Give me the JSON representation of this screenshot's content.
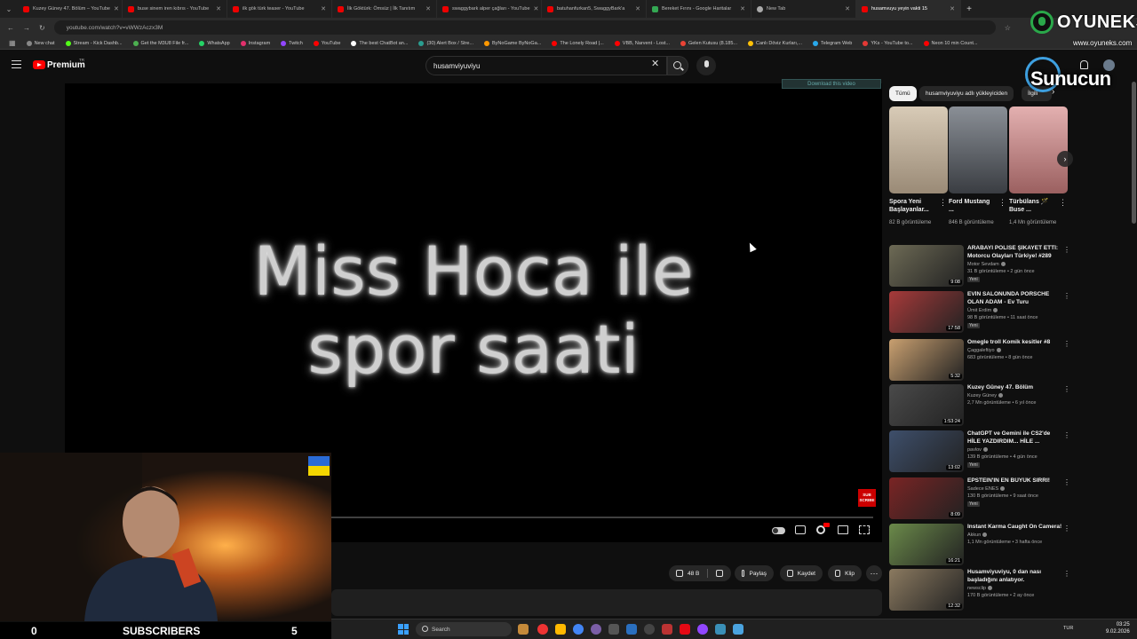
{
  "browser": {
    "tabs": [
      {
        "label": "Kuzey Güney 47. Bölüm – YouTube",
        "icon": "youtube-icon"
      },
      {
        "label": "buse sinem iren kıbrıs - YouTube",
        "icon": "youtube-icon"
      },
      {
        "label": "ilk gök türk teaser - YouTube",
        "icon": "youtube-icon"
      },
      {
        "label": "İlk Göktürk: Ömsüz | İlk Tanıtım",
        "icon": "youtube-icon"
      },
      {
        "label": "swaggybark alper çağları - YouTube",
        "icon": "youtube-icon"
      },
      {
        "label": "batuhanfurkan5, SwaggyBark'a",
        "icon": "youtube-icon"
      },
      {
        "label": "Bereket Fırını - Google Haritalar",
        "icon": "maps-icon"
      },
      {
        "label": "New Tab",
        "icon": "globe-icon"
      },
      {
        "label": "husamvuyu yeyin vakti 15",
        "icon": "youtube-icon"
      }
    ],
    "new_tab": "+",
    "url": "youtube.com/watch?v=vWWzAczx3M",
    "bookmarks": [
      "New chat",
      "Stream - Kick Dashb...",
      "Get the M3U8 File fr...",
      "WhatsApp",
      "Instagram",
      "Twitch",
      "YouTube",
      "The best ChatBot an...",
      "(30) Alert Box / Stre...",
      "ByNoGame ByNoGa...",
      "The Lonely Road |...",
      "VBB, Narvent - Lost...",
      "Gelen Kutusu (8.185...",
      "Canlı Döviz Kurları,...",
      "Telegram Web",
      "YKs - YouTube to...",
      "Neon 10 min Count..."
    ]
  },
  "youtube": {
    "brand": "Premium",
    "region": "TR",
    "search_query": "husamviyuviyu",
    "clear_symbol": "✕"
  },
  "player": {
    "download_label": "Download this video",
    "overlay_text_line1": "Miss Hoca ile",
    "overlay_text_line2": "spor saati",
    "subscribe_badge": "SUB SCRIBE"
  },
  "actions": {
    "likes": "48 B",
    "share": "Paylaş",
    "save": "Kaydet",
    "clip": "Klip",
    "more": "⋯"
  },
  "chips": {
    "all": "Tümü",
    "uploader": "husamviyuviyu adlı yükleyiciden",
    "related": "İlgili"
  },
  "shorts": [
    {
      "title": "Spora Yeni Başlayanlar...",
      "views": "82 B görüntüleme",
      "thumb_color": "#b9a894"
    },
    {
      "title": "Ford Mustang ...",
      "views": "846 B görüntüleme",
      "thumb_color": "#5a5f66"
    },
    {
      "title": "Türbülans 🪄 Buse ...",
      "views": "1,4 Mn görüntüleme",
      "thumb_color": "#c98a8a"
    }
  ],
  "recommended": [
    {
      "title": "ARABAYI POLİSE ŞİKAYET ETTİ: Motorcu Olayları Türkiye! #289",
      "channel": "Motor Sevdam",
      "meta": "31 B görüntüleme • 2 gün önce",
      "badge": "Yeni",
      "duration": "9:08",
      "thumb_color": "#6d6a55"
    },
    {
      "title": "EVİN SALONUNDA PORSCHE OLAN ADAM - Ev Turu",
      "channel": "Ümit Erdim",
      "meta": "98 B görüntüleme • 11 saat önce",
      "badge": "Yeni",
      "duration": "17:58",
      "thumb_color": "#a73a3a"
    },
    {
      "title": "Omegle troll Komik kesitler #8",
      "channel": "Çaggaleftiyo",
      "meta": "683 görüntüleme • 8 gün önce",
      "badge": "",
      "duration": "5:32",
      "thumb_color": "#c9a070"
    },
    {
      "title": "Kuzey Güney 47. Bölüm",
      "channel": "Kuzey Güney",
      "meta": "2,7 Mn görüntüleme • 6 yıl önce",
      "badge": "",
      "duration": "1:53:24",
      "thumb_color": "#4a4a4a"
    },
    {
      "title": "ChatGPT ve Gemini ile CS2'de HİLE YAZDIRDIM... HİLE ...",
      "channel": "pavlov",
      "meta": "139 B görüntüleme • 4 gün önce",
      "badge": "Yeni",
      "duration": "13:02",
      "thumb_color": "#3e4f6b"
    },
    {
      "title": "EPSTEIN'IN EN BÜYÜK SIRRI!",
      "channel": "Sadece ENES",
      "meta": "130 B görüntüleme • 9 saat önce",
      "badge": "Yeni",
      "duration": "8:09",
      "thumb_color": "#7a2424"
    },
    {
      "title": "Instant Karma Caught On Camera!",
      "channel": "Akkun",
      "meta": "1,1 Mn görüntüleme • 3 hafta önce",
      "badge": "",
      "duration": "16:21",
      "thumb_color": "#6b8a4a"
    },
    {
      "title": "Husamviyuviyu, 0 dan nası başladığını anlatıyor.",
      "channel": "newsclip",
      "meta": "170 B görüntüleme • 2 ay önce",
      "badge": "",
      "duration": "12:32",
      "thumb_color": "#8b7a60"
    }
  ],
  "overlays": {
    "brand": "OYUNEKS",
    "brand_url": "www.oyuneks.com",
    "sponsor": "Sunucun",
    "sub_left": "0",
    "sub_label": "SUBSCRIBERS",
    "sub_right": "5"
  },
  "taskbar": {
    "search": "Search",
    "lang": "TUR",
    "time": "03:25",
    "date": "9.02.2026"
  },
  "colors": {
    "accent": "#ff0000",
    "oyuneks_green": "#2aa84a"
  }
}
